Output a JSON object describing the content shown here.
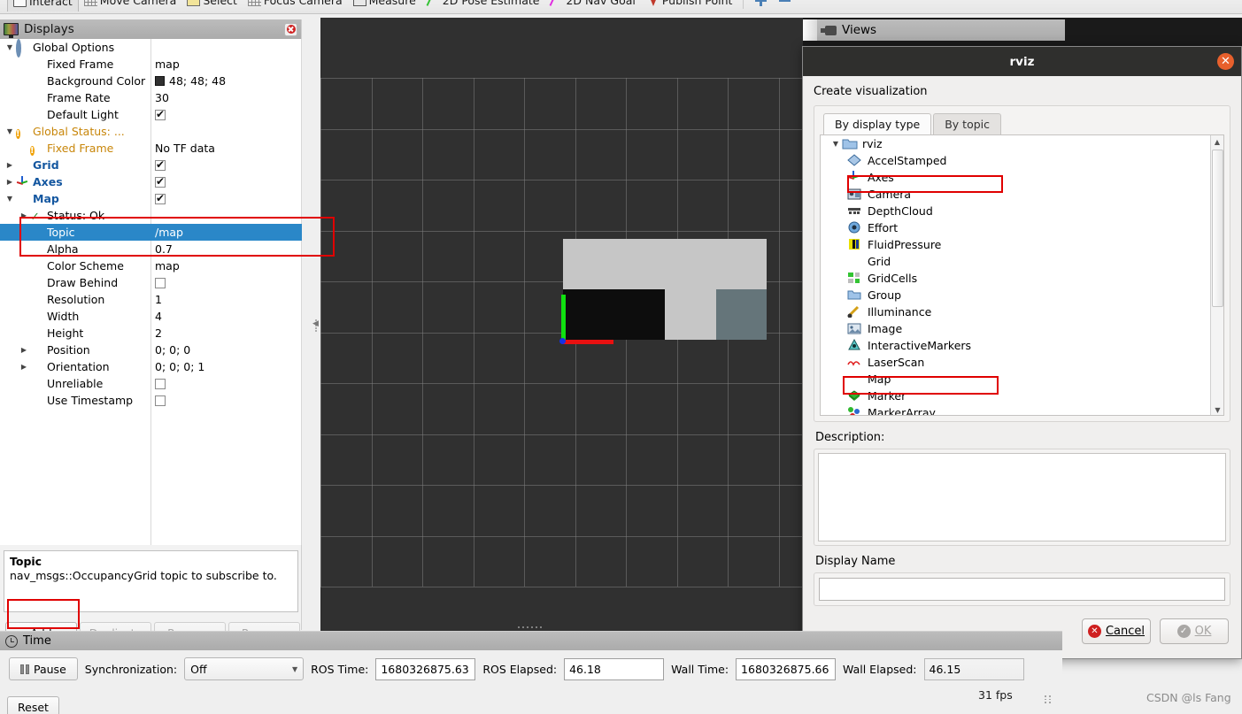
{
  "toolbar": {
    "items": [
      {
        "label": "Interact",
        "icon": "interact-icon",
        "active": true
      },
      {
        "label": "Move Camera",
        "icon": "move-camera-icon",
        "active": false
      },
      {
        "label": "Select",
        "icon": "select-icon",
        "active": false
      },
      {
        "label": "Focus Camera",
        "icon": "focus-camera-icon",
        "active": false
      },
      {
        "label": "Measure",
        "icon": "measure-icon",
        "active": false
      },
      {
        "label": "2D Pose Estimate",
        "icon": "pose-estimate-icon",
        "active": false
      },
      {
        "label": "2D Nav Goal",
        "icon": "nav-goal-icon",
        "active": false
      },
      {
        "label": "Publish Point",
        "icon": "publish-point-icon",
        "active": false
      }
    ]
  },
  "displays": {
    "title": "Displays",
    "rows": [
      {
        "indent": 0,
        "arrow": "down",
        "icon": "gear-icon",
        "label": "Global Options",
        "value": "",
        "style": "plain"
      },
      {
        "indent": 1,
        "arrow": "",
        "icon": "",
        "label": "Fixed Frame",
        "value": "map",
        "style": "plain"
      },
      {
        "indent": 1,
        "arrow": "",
        "icon": "",
        "label": "Background Color",
        "value": "48; 48; 48",
        "style": "swatch"
      },
      {
        "indent": 1,
        "arrow": "",
        "icon": "",
        "label": "Frame Rate",
        "value": "30",
        "style": "plain"
      },
      {
        "indent": 1,
        "arrow": "",
        "icon": "",
        "label": "Default Light",
        "value": "",
        "style": "checked"
      },
      {
        "indent": 0,
        "arrow": "down",
        "icon": "warning-icon",
        "label": "Global Status: ...",
        "value": "",
        "style": "warn"
      },
      {
        "indent": 1,
        "arrow": "",
        "icon": "warning-icon",
        "label": "Fixed Frame",
        "value": "No TF data",
        "style": "warn"
      },
      {
        "indent": 0,
        "arrow": "right",
        "icon": "grid-icon",
        "label": "Grid",
        "value": "",
        "style": "checked-blue"
      },
      {
        "indent": 0,
        "arrow": "right",
        "icon": "axes-icon",
        "label": "Axes",
        "value": "",
        "style": "checked-blue"
      },
      {
        "indent": 0,
        "arrow": "down",
        "icon": "map-icon",
        "label": "Map",
        "value": "",
        "style": "checked-blue"
      },
      {
        "indent": 1,
        "arrow": "right",
        "icon": "check-icon",
        "label": "Status: Ok",
        "value": "",
        "style": "plain"
      },
      {
        "indent": 1,
        "arrow": "",
        "icon": "",
        "label": "Topic",
        "value": "/map",
        "style": "selected"
      },
      {
        "indent": 1,
        "arrow": "",
        "icon": "",
        "label": "Alpha",
        "value": "0.7",
        "style": "plain"
      },
      {
        "indent": 1,
        "arrow": "",
        "icon": "",
        "label": "Color Scheme",
        "value": "map",
        "style": "plain"
      },
      {
        "indent": 1,
        "arrow": "",
        "icon": "",
        "label": "Draw Behind",
        "value": "",
        "style": "unchecked"
      },
      {
        "indent": 1,
        "arrow": "",
        "icon": "",
        "label": "Resolution",
        "value": "1",
        "style": "plain"
      },
      {
        "indent": 1,
        "arrow": "",
        "icon": "",
        "label": "Width",
        "value": "4",
        "style": "plain"
      },
      {
        "indent": 1,
        "arrow": "",
        "icon": "",
        "label": "Height",
        "value": "2",
        "style": "plain"
      },
      {
        "indent": 1,
        "arrow": "right",
        "icon": "",
        "label": "Position",
        "value": "0; 0; 0",
        "style": "plain"
      },
      {
        "indent": 1,
        "arrow": "right",
        "icon": "",
        "label": "Orientation",
        "value": "0; 0; 0; 1",
        "style": "plain"
      },
      {
        "indent": 1,
        "arrow": "",
        "icon": "",
        "label": "Unreliable",
        "value": "",
        "style": "unchecked"
      },
      {
        "indent": 1,
        "arrow": "",
        "icon": "",
        "label": "Use Timestamp",
        "value": "",
        "style": "unchecked"
      }
    ],
    "description": {
      "title": "Topic",
      "text": "nav_msgs::OccupancyGrid topic to subscribe to."
    },
    "buttons": [
      {
        "label": "Add",
        "enabled": true
      },
      {
        "label": "Duplicate",
        "enabled": false
      },
      {
        "label": "Remove",
        "enabled": false
      },
      {
        "label": "Rename",
        "enabled": false
      }
    ]
  },
  "views_panel": {
    "title": "Views"
  },
  "dialog": {
    "title": "rviz",
    "heading": "Create visualization",
    "tabs": [
      {
        "label": "By display type",
        "active": true
      },
      {
        "label": "By topic",
        "active": false
      }
    ],
    "tree_root": {
      "label": "rviz",
      "icon": "folder-icon"
    },
    "display_types": [
      {
        "label": "AccelStamped",
        "icon": "accel-stamped-icon",
        "highlight": false
      },
      {
        "label": "Axes",
        "icon": "axes-icon",
        "highlight": true
      },
      {
        "label": "Camera",
        "icon": "camera-icon",
        "highlight": false
      },
      {
        "label": "DepthCloud",
        "icon": "depth-cloud-icon",
        "highlight": false
      },
      {
        "label": "Effort",
        "icon": "effort-icon",
        "highlight": false
      },
      {
        "label": "FluidPressure",
        "icon": "fluid-pressure-icon",
        "highlight": false
      },
      {
        "label": "Grid",
        "icon": "grid-icon",
        "highlight": false
      },
      {
        "label": "GridCells",
        "icon": "grid-cells-icon",
        "highlight": false
      },
      {
        "label": "Group",
        "icon": "folder-icon",
        "highlight": false
      },
      {
        "label": "Illuminance",
        "icon": "illuminance-icon",
        "highlight": false
      },
      {
        "label": "Image",
        "icon": "image-icon",
        "highlight": false
      },
      {
        "label": "InteractiveMarkers",
        "icon": "interactive-markers-icon",
        "highlight": false
      },
      {
        "label": "LaserScan",
        "icon": "laser-scan-icon",
        "highlight": false
      },
      {
        "label": "Map",
        "icon": "map-icon",
        "highlight": true
      },
      {
        "label": "Marker",
        "icon": "marker-icon",
        "highlight": false
      },
      {
        "label": "MarkerArray",
        "icon": "marker-array-icon",
        "highlight": false
      }
    ],
    "description_label": "Description:",
    "description_value": "",
    "display_name_label": "Display Name",
    "display_name_value": "",
    "cancel_label": "Cancel",
    "ok_label": "OK"
  },
  "time_panel": {
    "title": "Time",
    "pause_label": "Pause",
    "sync_label": "Synchronization:",
    "sync_value": "Off",
    "ros_time_label": "ROS Time:",
    "ros_time_value": "1680326875.63",
    "ros_elapsed_label": "ROS Elapsed:",
    "ros_elapsed_value": "46.18",
    "wall_time_label": "Wall Time:",
    "wall_time_value": "1680326875.66",
    "wall_elapsed_label": "Wall Elapsed:",
    "wall_elapsed_value": "46.15",
    "reset_label": "Reset",
    "fps": "31 fps"
  },
  "watermark": "CSDN @ls Fang",
  "viewport": {
    "background_color": "#303030",
    "grid_color": "#7e7e7e",
    "occupancy_map": {
      "width": 4,
      "height": 2,
      "cell_colors": [
        [
          "#c6c6c6",
          "#c6c6c6",
          "#c6c6c6",
          "#c6c6c6"
        ],
        [
          "#0d0d0d",
          "#0d0d0d",
          "#c6c6c6",
          "#65757a"
        ]
      ]
    },
    "axes_marker": {
      "x_color": "#e81010",
      "y_color": "#10e010",
      "z_color": "#1530e8"
    }
  }
}
